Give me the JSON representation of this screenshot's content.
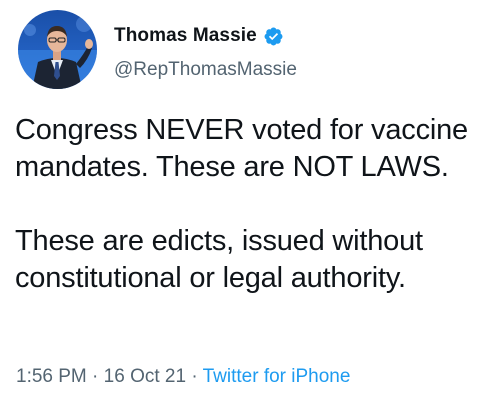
{
  "author": {
    "display_name": "Thomas Massie",
    "handle": "@RepThomasMassie",
    "verified": true,
    "avatar_icon": "profile-photo",
    "verified_icon": "verified-badge-icon",
    "verified_color": "#1d9bf0"
  },
  "tweet": {
    "paragraphs": [
      "Congress NEVER voted for vaccine mandates. These are NOT LAWS.",
      "These are edicts, issued without constitutional or legal authority."
    ]
  },
  "meta": {
    "time": "1:56 PM",
    "separator": "·",
    "date": "16 Oct 21",
    "source": "Twitter for iPhone"
  },
  "colors": {
    "text_primary": "#0f1419",
    "text_secondary": "#536471",
    "accent": "#1d9bf0"
  }
}
